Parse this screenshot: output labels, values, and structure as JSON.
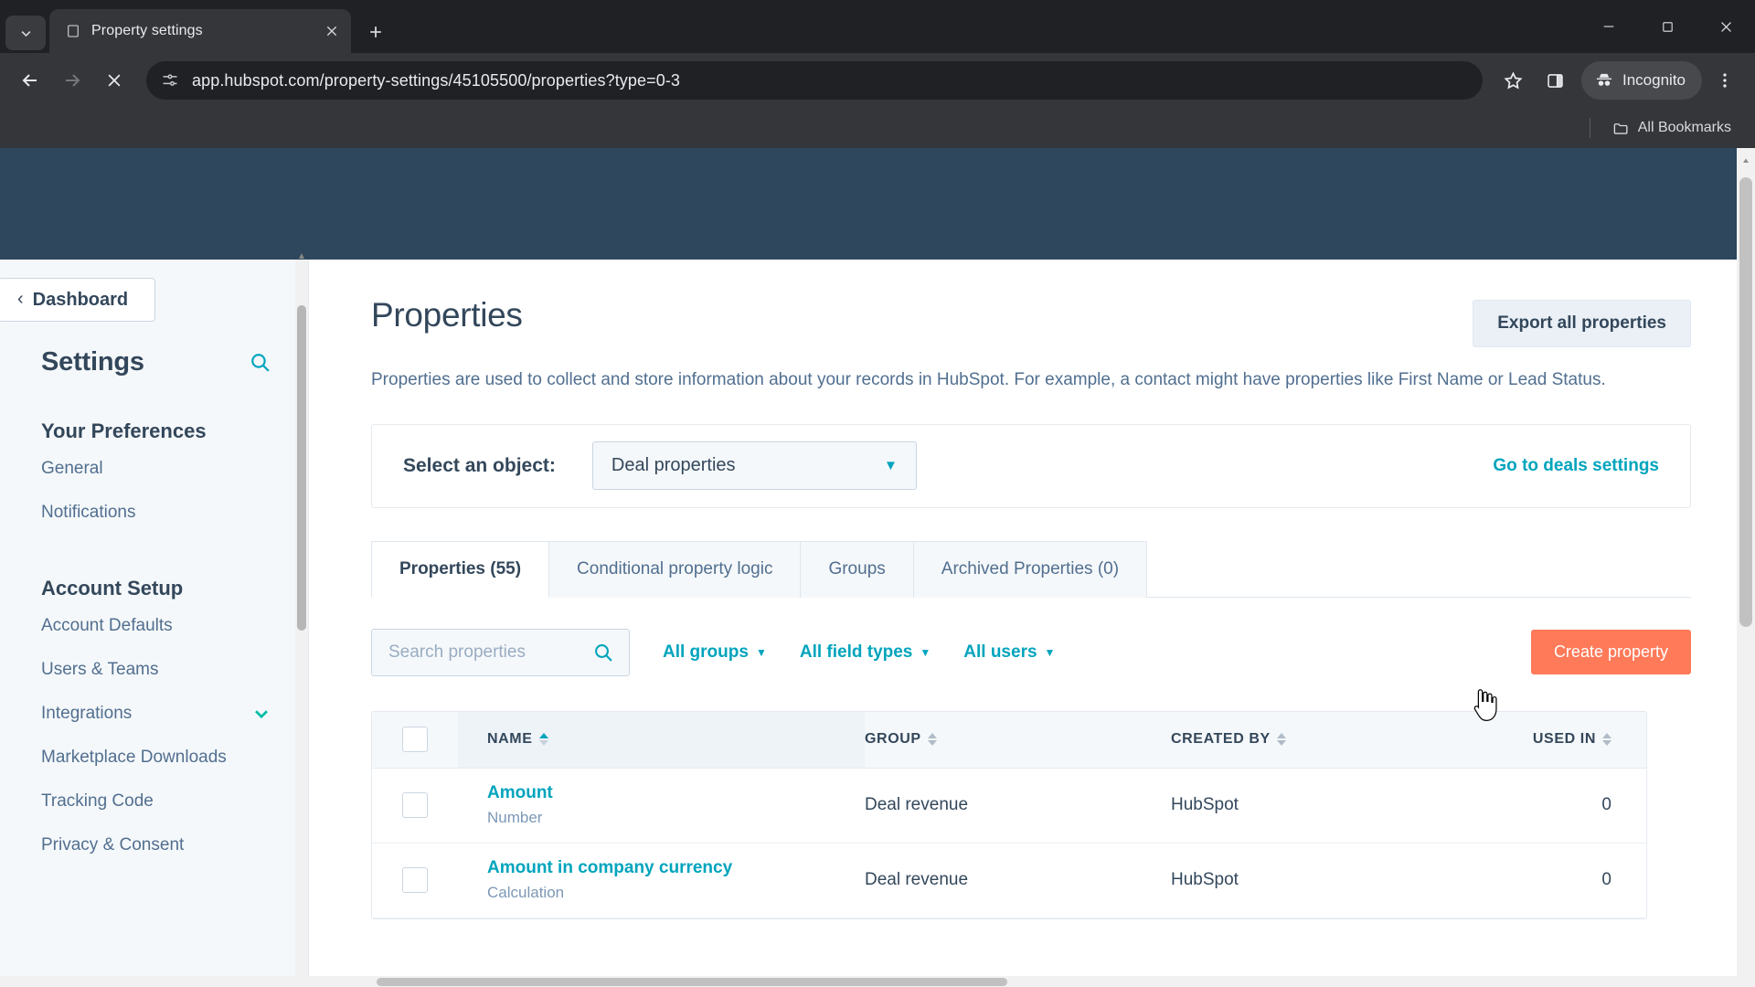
{
  "browser": {
    "tab": {
      "title": "Property settings",
      "favicon_icon": "page-icon",
      "close_icon": "close-icon"
    },
    "tab_search_icon": "chevron-down-icon",
    "new_tab_icon": "plus-icon",
    "window_controls": {
      "minimize": "minimize-icon",
      "maximize": "maximize-icon",
      "close": "close-icon"
    },
    "nav": {
      "back_icon": "arrow-left-icon",
      "forward_icon": "arrow-right-icon",
      "stop_icon": "close-icon"
    },
    "omnibox": {
      "url": "app.hubspot.com/property-settings/45105500/properties?type=0-3",
      "site_icon": "site-settings-icon"
    },
    "toolbar_icons": {
      "bookmark": "star-icon",
      "side_panel": "side-panel-icon",
      "menu": "kebab-menu-icon"
    },
    "incognito": {
      "label": "Incognito",
      "icon": "incognito-icon"
    },
    "bookmarks_bar": {
      "all_bookmarks_label": "All Bookmarks",
      "folder_icon": "folder-icon"
    }
  },
  "sidebar": {
    "back_button": {
      "label": "Dashboard",
      "icon": "chevron-left-icon"
    },
    "heading": "Settings",
    "search_icon": "search-icon",
    "sections": [
      {
        "title": "Your Preferences",
        "items": [
          {
            "label": "General",
            "caret": false
          },
          {
            "label": "Notifications",
            "caret": false
          }
        ]
      },
      {
        "title": "Account Setup",
        "items": [
          {
            "label": "Account Defaults",
            "caret": false
          },
          {
            "label": "Users & Teams",
            "caret": false
          },
          {
            "label": "Integrations",
            "caret": true
          },
          {
            "label": "Marketplace Downloads",
            "caret": false
          },
          {
            "label": "Tracking Code",
            "caret": false
          },
          {
            "label": "Privacy & Consent",
            "caret": false
          }
        ]
      }
    ]
  },
  "main": {
    "title": "Properties",
    "export_button": "Export all properties",
    "description": "Properties are used to collect and store information about your records in HubSpot. For example, a contact might have properties like First Name or Lead Status.",
    "object_card": {
      "label": "Select an object:",
      "selected": "Deal properties",
      "dropdown_icon": "chevron-down-icon",
      "link": "Go to deals settings"
    },
    "tabs": [
      {
        "label": "Properties (55)",
        "active": true
      },
      {
        "label": "Conditional property logic",
        "active": false
      },
      {
        "label": "Groups",
        "active": false
      },
      {
        "label": "Archived Properties (0)",
        "active": false
      }
    ],
    "filters": {
      "search_placeholder": "Search properties",
      "search_value": "",
      "search_icon": "search-icon",
      "groups": "All groups",
      "field_types": "All field types",
      "users": "All users",
      "create_button": "Create property"
    },
    "table": {
      "columns": [
        "NAME",
        "GROUP",
        "CREATED BY",
        "USED IN"
      ],
      "sorted_column": "NAME",
      "sort_direction": "asc",
      "rows": [
        {
          "name": "Amount",
          "type": "Number",
          "group": "Deal revenue",
          "created_by": "HubSpot",
          "used_in": "0"
        },
        {
          "name": "Amount in company currency",
          "type": "Calculation",
          "group": "Deal revenue",
          "created_by": "HubSpot",
          "used_in": "0"
        }
      ]
    }
  },
  "colors": {
    "hubspot_orange": "#ff7a59",
    "hubspot_teal": "#00a4bd",
    "hubspot_navy": "#2e475d",
    "sidebar_bg": "#f5f8fa",
    "text_primary": "#33475b"
  }
}
